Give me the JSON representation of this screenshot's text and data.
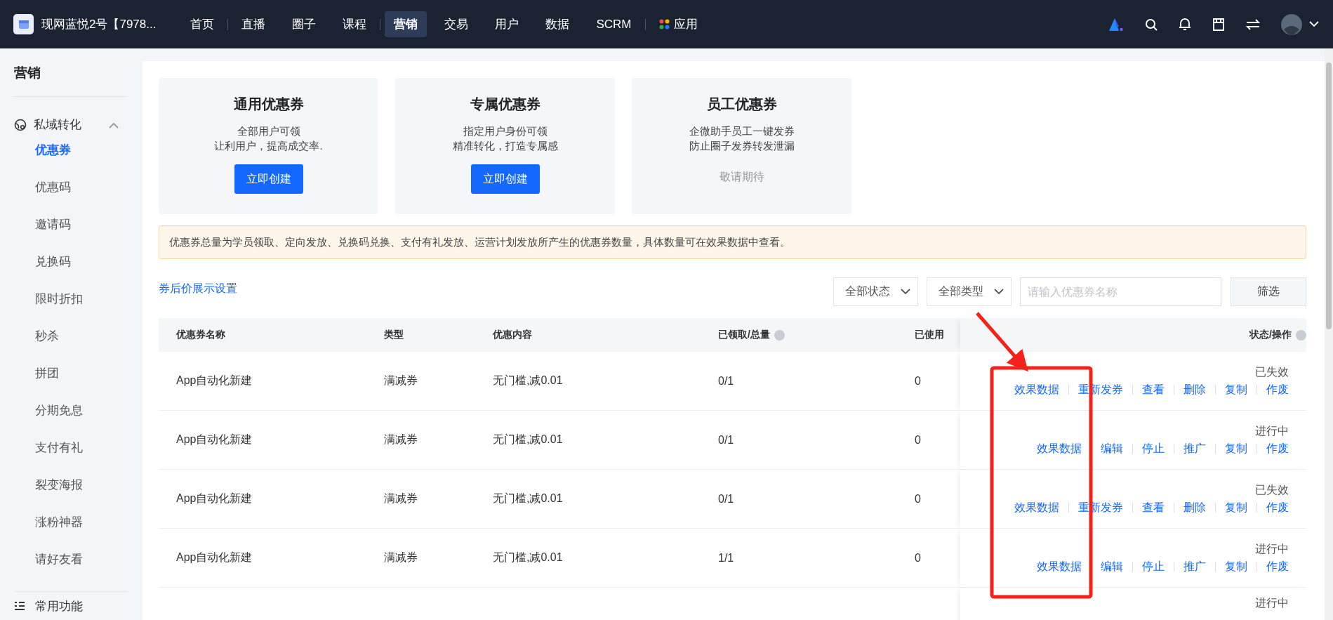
{
  "topbar": {
    "shop_name": "现网蓝悦2号【7978...",
    "nav": [
      {
        "label": "首页",
        "kind": "text",
        "selected": false,
        "divider_after": true
      },
      {
        "label": "直播",
        "kind": "text",
        "selected": false,
        "divider_after": false
      },
      {
        "label": "圈子",
        "kind": "text",
        "selected": false,
        "divider_after": false
      },
      {
        "label": "课程",
        "kind": "text",
        "selected": false,
        "divider_after": true
      },
      {
        "label": "营销",
        "kind": "text",
        "selected": true,
        "divider_after": false
      },
      {
        "label": "交易",
        "kind": "text",
        "selected": false,
        "divider_after": false
      },
      {
        "label": "用户",
        "kind": "text",
        "selected": false,
        "divider_after": false
      },
      {
        "label": "数据",
        "kind": "text",
        "selected": false,
        "divider_after": false
      },
      {
        "label": "SCRM",
        "kind": "text",
        "selected": false,
        "divider_after": true
      },
      {
        "label": "应用",
        "kind": "apps",
        "selected": false,
        "divider_after": false
      }
    ]
  },
  "sidebar": {
    "title": "营销",
    "group": {
      "label": "私域转化",
      "expanded": true,
      "children": [
        {
          "label": "优惠券",
          "selected": true
        },
        {
          "label": "优惠码",
          "selected": false
        },
        {
          "label": "邀请码",
          "selected": false
        },
        {
          "label": "兑换码",
          "selected": false
        },
        {
          "label": "限时折扣",
          "selected": false
        },
        {
          "label": "秒杀",
          "selected": false
        },
        {
          "label": "拼团",
          "selected": false
        },
        {
          "label": "分期免息",
          "selected": false
        },
        {
          "label": "支付有礼",
          "selected": false
        },
        {
          "label": "裂变海报",
          "selected": false
        },
        {
          "label": "涨粉神器",
          "selected": false
        },
        {
          "label": "请好友看",
          "selected": false
        }
      ]
    },
    "footer": "常用功能"
  },
  "promo_cards": [
    {
      "title": "通用优惠券",
      "lines": [
        "全部用户可领",
        "让利用户，提高成交率."
      ],
      "action": {
        "kind": "button",
        "label": "立即创建"
      }
    },
    {
      "title": "专属优惠券",
      "lines": [
        "指定用户身份可领",
        "精准转化，打造专属感"
      ],
      "action": {
        "kind": "button",
        "label": "立即创建"
      }
    },
    {
      "title": "员工优惠券",
      "lines": [
        "企微助手员工一键发券",
        "防止圈子发券转发泄漏"
      ],
      "action": {
        "kind": "text",
        "label": "敬请期待"
      }
    }
  ],
  "notice": "优惠券总量为学员领取、定向发放、兑换码兑换、支付有礼发放、运营计划发放所产生的优惠券数量，具体数量可在效果数据中查看。",
  "settings_link": "券后价展示设置",
  "filters": {
    "status": "全部状态",
    "type": "全部类型",
    "search_placeholder": "请输入优惠券名称",
    "button": "筛选"
  },
  "table": {
    "columns": [
      {
        "label": "优惠券名称",
        "info": false
      },
      {
        "label": "类型",
        "info": false
      },
      {
        "label": "优惠内容",
        "info": false
      },
      {
        "label": "已领取/总量",
        "info": true
      },
      {
        "label": "已使用",
        "info": false
      },
      {
        "label": "状态/操作",
        "info": true
      }
    ],
    "rows": [
      {
        "name": "App自动化新建",
        "type": "满减券",
        "content": "无门槛,减0.01",
        "claimed": "0/1",
        "used": "0",
        "status": "已失效",
        "actions": [
          "效果数据",
          "重新发券",
          "查看",
          "删除",
          "复制",
          "作废"
        ]
      },
      {
        "name": "App自动化新建",
        "type": "满减券",
        "content": "无门槛,减0.01",
        "claimed": "0/1",
        "used": "0",
        "status": "进行中",
        "actions": [
          "效果数据",
          "编辑",
          "停止",
          "推广",
          "复制",
          "作废"
        ]
      },
      {
        "name": "App自动化新建",
        "type": "满减券",
        "content": "无门槛,减0.01",
        "claimed": "0/1",
        "used": "0",
        "status": "已失效",
        "actions": [
          "效果数据",
          "重新发券",
          "查看",
          "删除",
          "复制",
          "作废"
        ]
      },
      {
        "name": "App自动化新建",
        "type": "满减券",
        "content": "无门槛,减0.01",
        "claimed": "1/1",
        "used": "0",
        "status": "进行中",
        "actions": [
          "效果数据",
          "编辑",
          "停止",
          "推广",
          "复制",
          "作废"
        ]
      },
      {
        "status": "进行中"
      }
    ]
  }
}
